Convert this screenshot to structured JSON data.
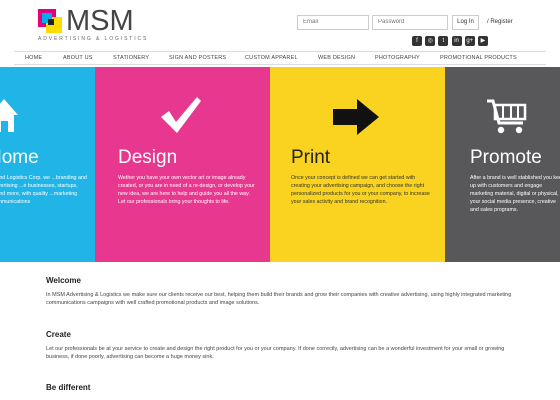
{
  "brand": {
    "name": "MSM",
    "tagline": "ADVERTISING & LOGISTICS"
  },
  "login": {
    "email_placeholder": "Email",
    "password_placeholder": "Password",
    "login_label": "Log In",
    "register_label": "/ Register"
  },
  "social": {
    "icons": [
      "facebook-icon",
      "instagram-icon",
      "twitter-icon",
      "linkedin-icon",
      "google-plus-icon",
      "youtube-icon"
    ]
  },
  "nav": {
    "items": [
      {
        "label": "HOME"
      },
      {
        "label": "ABOUT US"
      },
      {
        "label": "STATIONERY"
      },
      {
        "label": "SIGN AND POSTERS"
      },
      {
        "label": "CUSTOM APPAREL"
      },
      {
        "label": "WEB DESIGN"
      },
      {
        "label": "PHOTOGRAPHY"
      },
      {
        "label": "PROMOTIONAL PRODUCTS"
      }
    ]
  },
  "banner": {
    "panels": [
      {
        "title": "Home",
        "icon": "home-icon",
        "color": "#21b4e6",
        "desc": "...and Logistics Corp. we ...branding and advertising ...e businesses, startups, ...and more, with quality ...marketing communications"
      },
      {
        "title": "Design",
        "icon": "checkmark-icon",
        "color": "#e7378f",
        "desc": "Wether you have your own vector art or image already created, or you are in need of a re-design, or develop your new idea, we are here to help and guide you all the way. Let our professionals bring your thoughts to life."
      },
      {
        "title": "Print",
        "icon": "arrow-right-icon",
        "color": "#f9d31f",
        "desc": "Once your concept is defined we can get started with creating your advertising campaign, and choose the right personalized products for you or your company, to increase your sales activity and brand recognition."
      },
      {
        "title": "Promote",
        "icon": "cart-icon",
        "color": "#58585a",
        "desc": "After a brand is well stablished you keep up with customers and engage marketing material, digital or physical, your social media presence, creative and sales programs."
      }
    ]
  },
  "content": {
    "sections": [
      {
        "heading": "Welcome",
        "body": "In MSM Advertising & Logistics we make sure our clients receive our best, helping them build their brands and grow their companies with creative advertising, using highly integrated marketing communications campaigns with well crafted promotional products and image solutions."
      },
      {
        "heading": "Create",
        "body": "Let our professionals be at your service to create and design the right product for you or your company. If done correctly, advertising can be a wonderful investment for your small or growing business, if done poorly, advertising can become a huge money sink."
      },
      {
        "heading": "Be different",
        "body": ""
      }
    ]
  }
}
